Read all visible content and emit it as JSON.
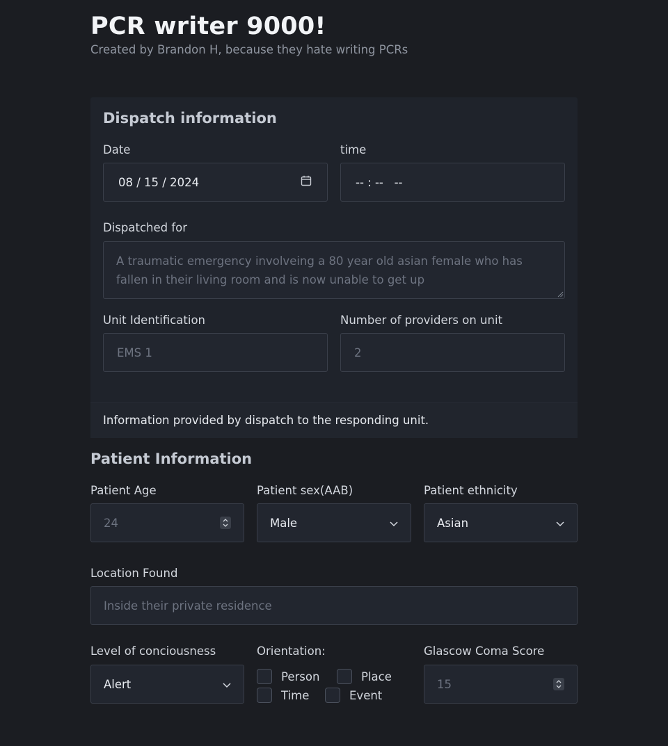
{
  "header": {
    "title": "PCR writer 9000!",
    "subtitle": "Created by Brandon H, because they hate writing PCRs"
  },
  "dispatch": {
    "title": "Dispatch information",
    "date_label": "Date",
    "date_value": "08 / 15 / 2024",
    "time_label": "time",
    "time_value": "-- : --   --",
    "dispatched_for_label": "Dispatched for",
    "dispatched_for_placeholder": "A traumatic emergency involveing a 80 year old asian female who has fallen in their living room and is now unable to get up",
    "unit_label": "Unit Identification",
    "unit_placeholder": "EMS 1",
    "providers_label": "Number of providers on unit",
    "providers_placeholder": "2",
    "footer": "Information provided by dispatch to the responding unit."
  },
  "patient": {
    "title": "Patient Information",
    "age_label": "Patient Age",
    "age_placeholder": "24",
    "sex_label": "Patient sex(AAB)",
    "sex_value": "Male",
    "ethnicity_label": "Patient ethnicity",
    "ethnicity_value": "Asian",
    "location_label": "Location Found",
    "location_placeholder": "Inside their private residence",
    "loc_label": "Level of conciousness",
    "loc_value": "Alert",
    "orientation_label": "Orientation:",
    "orientation_options": [
      "Person",
      "Place",
      "Time",
      "Event"
    ],
    "gcs_label": "Glascow Coma Score",
    "gcs_placeholder": "15"
  },
  "icons": {
    "calendar": "calendar-icon",
    "chevron": "chevron-down-icon",
    "spinner": "number-spinner-icon"
  }
}
